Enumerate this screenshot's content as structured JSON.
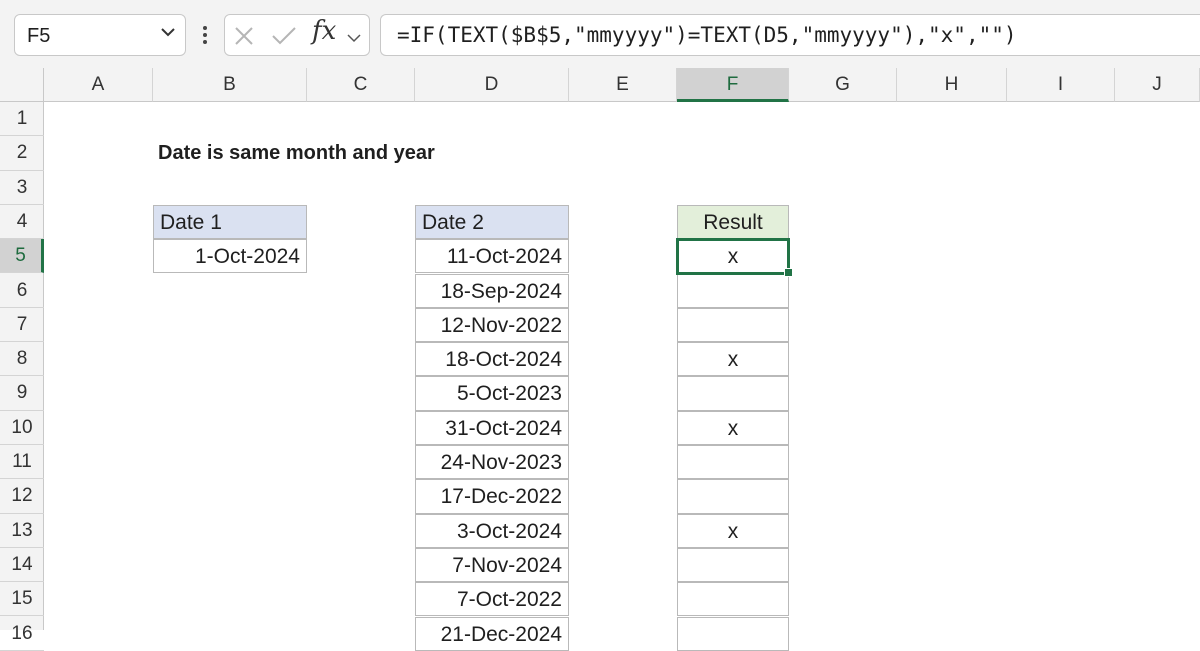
{
  "formula_bar": {
    "name_box": "F5",
    "fx_label": "fx",
    "formula": "=IF(TEXT($B$5,\"mmyyyy\")=TEXT(D5,\"mmyyyy\"),\"x\",\"\")"
  },
  "columns": [
    "A",
    "B",
    "C",
    "D",
    "E",
    "F",
    "G",
    "H",
    "I",
    "J"
  ],
  "active_column": "F",
  "rows": [
    "1",
    "2",
    "3",
    "4",
    "5",
    "6",
    "7",
    "8",
    "9",
    "10",
    "11",
    "12",
    "13",
    "14",
    "15",
    "16"
  ],
  "active_row": "5",
  "sheet": {
    "title": "Date is same month and year",
    "date1_header": "Date 1",
    "date1_value": "1-Oct-2024",
    "date2_header": "Date 2",
    "result_header": "Result",
    "date2_values": [
      "11-Oct-2024",
      "18-Sep-2024",
      "12-Nov-2022",
      "18-Oct-2024",
      "5-Oct-2023",
      "31-Oct-2024",
      "24-Nov-2023",
      "17-Dec-2022",
      "3-Oct-2024",
      "7-Nov-2024",
      "7-Oct-2022",
      "21-Dec-2024"
    ],
    "results": [
      "x",
      "",
      "",
      "x",
      "",
      "x",
      "",
      "",
      "x",
      "",
      "",
      ""
    ]
  },
  "colors": {
    "accent": "#217346",
    "date_header_fill": "#dae1f1",
    "result_header_fill": "#e3efda"
  }
}
